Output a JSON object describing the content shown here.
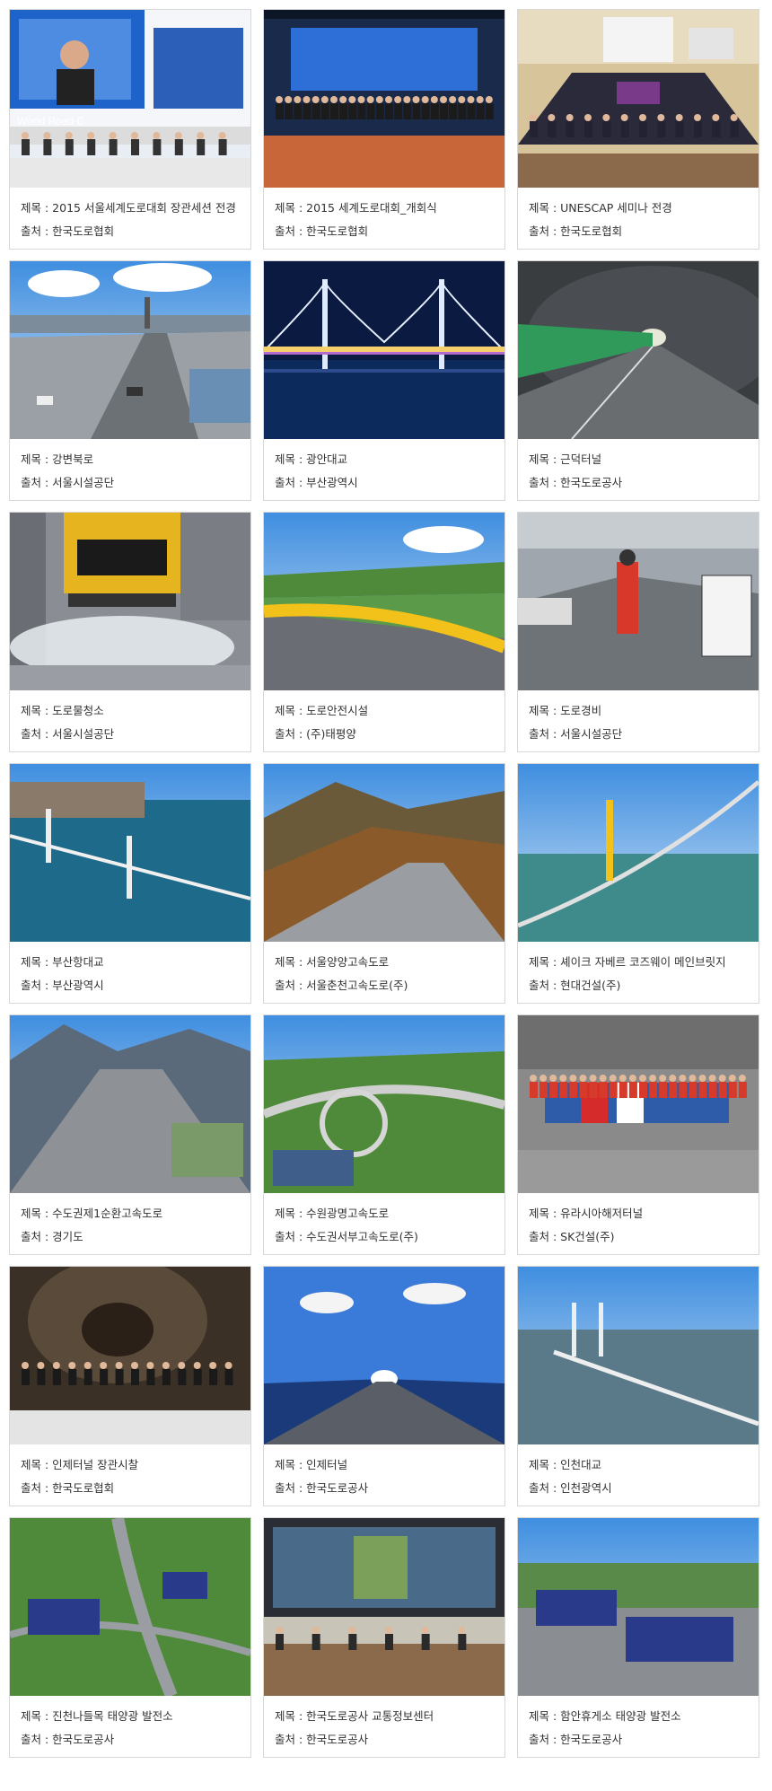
{
  "labels": {
    "title_prefix": "제목 : ",
    "source_prefix": "출처 : "
  },
  "items": [
    {
      "title": "2015 서울세계도로대회 장관세션 전경",
      "source": "한국도로협회",
      "scene": "conference"
    },
    {
      "title": "2015 세계도로대회_개회식",
      "source": "한국도로협회",
      "scene": "group-stage"
    },
    {
      "title": "UNESCAP 세미나 전경",
      "source": "한국도로협회",
      "scene": "seminar"
    },
    {
      "title": "강변북로",
      "source": "서울시설공단",
      "scene": "riverside-highway"
    },
    {
      "title": "광안대교",
      "source": "부산광역시",
      "scene": "night-bridge"
    },
    {
      "title": "근덕터널",
      "source": "한국도로공사",
      "scene": "tunnel"
    },
    {
      "title": "도로물청소",
      "source": "서울시설공단",
      "scene": "street-cleaning"
    },
    {
      "title": "도로안전시설",
      "source": "(주)태평양",
      "scene": "guardrail"
    },
    {
      "title": "도로경비",
      "source": "서울시설공단",
      "scene": "traffic-guard"
    },
    {
      "title": "부산항대교",
      "source": "부산광역시",
      "scene": "harbor-bridge"
    },
    {
      "title": "서울양양고속도로",
      "source": "서울춘천고속도로(주)",
      "scene": "mountain-highway"
    },
    {
      "title": "셰이크 자베르 코즈웨이 메인브릿지",
      "source": "현대건설(주)",
      "scene": "causeway"
    },
    {
      "title": "수도권제1순환고속도로",
      "source": "경기도",
      "scene": "ring-expressway"
    },
    {
      "title": "수원광명고속도로",
      "source": "수도권서부고속도로(주)",
      "scene": "interchange"
    },
    {
      "title": "유라시아해저터널",
      "source": "SK건설(주)",
      "scene": "undersea-tunnel"
    },
    {
      "title": "인제터널 장관시찰",
      "source": "한국도로협회",
      "scene": "tunnel-visit"
    },
    {
      "title": "인제터널",
      "source": "한국도로공사",
      "scene": "sky-tunnel"
    },
    {
      "title": "인천대교",
      "source": "인천광역시",
      "scene": "sea-bridge"
    },
    {
      "title": "진천나들목 태양광 발전소",
      "source": "한국도로공사",
      "scene": "solar-interchange"
    },
    {
      "title": "한국도로공사 교통정보센터",
      "source": "한국도로공사",
      "scene": "control-center"
    },
    {
      "title": "함안휴게소 태양광 발전소",
      "source": "한국도로공사",
      "scene": "solar-rest-area"
    }
  ]
}
